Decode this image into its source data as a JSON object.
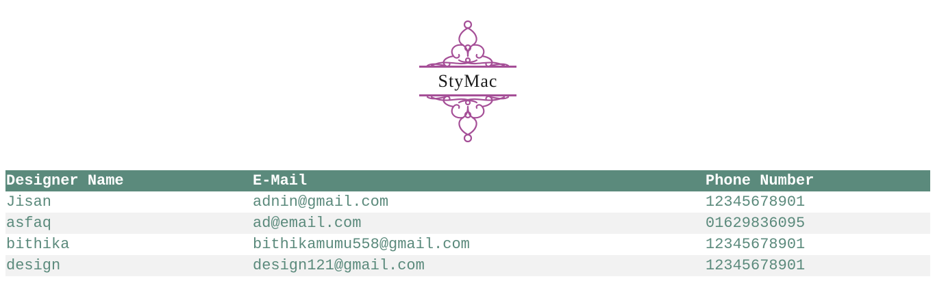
{
  "logo": {
    "text": "StyMac",
    "color": "#a54f97"
  },
  "table": {
    "header_color": "#5b8a7c",
    "columns": [
      "Designer Name",
      "E-Mail",
      "Phone Number"
    ],
    "rows": [
      {
        "name": "Jisan",
        "email": "adnin@gmail.com",
        "phone": "12345678901"
      },
      {
        "name": "asfaq",
        "email": "ad@email.com",
        "phone": "01629836095"
      },
      {
        "name": "bithika",
        "email": "bithikamumu558@gmail.com",
        "phone": "12345678901"
      },
      {
        "name": "design",
        "email": "design121@gmail.com",
        "phone": "12345678901"
      }
    ]
  }
}
